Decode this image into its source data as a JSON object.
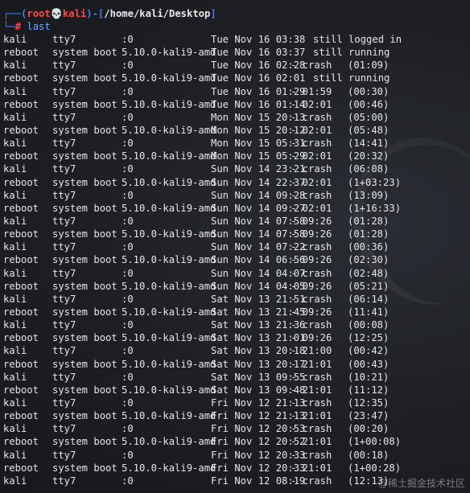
{
  "prompt": {
    "open": "┌──(",
    "user": "root",
    "skull": "💀",
    "host": "kali",
    "sep": ")-[",
    "path": "/home/kali/Desktop",
    "close": "]"
  },
  "command": {
    "prefix": "└─",
    "hash": "#",
    "text": "last"
  },
  "rows": [
    {
      "user": "kali",
      "tty": "tty7",
      "host": ":0",
      "date": "Tue Nov 16 03:38",
      "time": "",
      "status": "still logged in"
    },
    {
      "user": "reboot",
      "tty": "system boot",
      "host": "5.10.0-kali9-amd",
      "date": "Tue Nov 16 03:37",
      "time": "",
      "status": "still running"
    },
    {
      "user": "kali",
      "tty": "tty7",
      "host": ":0",
      "date": "Tue Nov 16 02:28",
      "time": "- crash",
      "status": "(01:09)"
    },
    {
      "user": "reboot",
      "tty": "system boot",
      "host": "5.10.0-kali9-amd",
      "date": "Tue Nov 16 02:01",
      "time": "",
      "status": "still running"
    },
    {
      "user": "kali",
      "tty": "tty7",
      "host": ":0",
      "date": "Tue Nov 16 01:29",
      "time": "- 01:59",
      "status": "(00:30)"
    },
    {
      "user": "reboot",
      "tty": "system boot",
      "host": "5.10.0-kali9-amd",
      "date": "Tue Nov 16 01:14",
      "time": "- 02:01",
      "status": "(00:46)"
    },
    {
      "user": "kali",
      "tty": "tty7",
      "host": ":0",
      "date": "Mon Nov 15 20:13",
      "time": "- crash",
      "status": "(05:00)"
    },
    {
      "user": "reboot",
      "tty": "system boot",
      "host": "5.10.0-kali9-amd",
      "date": "Mon Nov 15 20:12",
      "time": "- 02:01",
      "status": "(05:48)"
    },
    {
      "user": "kali",
      "tty": "tty7",
      "host": ":0",
      "date": "Mon Nov 15 05:31",
      "time": "- crash",
      "status": "(14:41)"
    },
    {
      "user": "reboot",
      "tty": "system boot",
      "host": "5.10.0-kali9-amd",
      "date": "Mon Nov 15 05:29",
      "time": "- 02:01",
      "status": "(20:32)"
    },
    {
      "user": "kali",
      "tty": "tty7",
      "host": ":0",
      "date": "Sun Nov 14 23:21",
      "time": "- crash",
      "status": "(06:08)"
    },
    {
      "user": "reboot",
      "tty": "system boot",
      "host": "5.10.0-kali9-amd",
      "date": "Sun Nov 14 22:37",
      "time": "- 02:01",
      "status": "(1+03:23)"
    },
    {
      "user": "kali",
      "tty": "tty7",
      "host": ":0",
      "date": "Sun Nov 14 09:28",
      "time": "- crash",
      "status": "(13:09)"
    },
    {
      "user": "reboot",
      "tty": "system boot",
      "host": "5.10.0-kali9-amd",
      "date": "Sun Nov 14 09:27",
      "time": "- 02:01",
      "status": "(1+16:33)"
    },
    {
      "user": "kali",
      "tty": "tty7",
      "host": ":0",
      "date": "Sun Nov 14 07:58",
      "time": "- 09:26",
      "status": "(01:28)"
    },
    {
      "user": "reboot",
      "tty": "system boot",
      "host": "5.10.0-kali9-amd",
      "date": "Sun Nov 14 07:58",
      "time": "- 09:26",
      "status": "(01:28)"
    },
    {
      "user": "kali",
      "tty": "tty7",
      "host": ":0",
      "date": "Sun Nov 14 07:22",
      "time": "- crash",
      "status": "(00:36)"
    },
    {
      "user": "reboot",
      "tty": "system boot",
      "host": "5.10.0-kali9-amd",
      "date": "Sun Nov 14 06:56",
      "time": "- 09:26",
      "status": "(02:30)"
    },
    {
      "user": "kali",
      "tty": "tty7",
      "host": ":0",
      "date": "Sun Nov 14 04:07",
      "time": "- crash",
      "status": "(02:48)"
    },
    {
      "user": "reboot",
      "tty": "system boot",
      "host": "5.10.0-kali9-amd",
      "date": "Sun Nov 14 04:05",
      "time": "- 09:26",
      "status": "(05:21)"
    },
    {
      "user": "kali",
      "tty": "tty7",
      "host": ":0",
      "date": "Sat Nov 13 21:51",
      "time": "- crash",
      "status": "(06:14)"
    },
    {
      "user": "reboot",
      "tty": "system boot",
      "host": "5.10.0-kali9-amd",
      "date": "Sat Nov 13 21:45",
      "time": "- 09:26",
      "status": "(11:41)"
    },
    {
      "user": "kali",
      "tty": "tty7",
      "host": ":0",
      "date": "Sat Nov 13 21:36",
      "time": "- crash",
      "status": "(00:08)"
    },
    {
      "user": "reboot",
      "tty": "system boot",
      "host": "5.10.0-kali9-amd",
      "date": "Sat Nov 13 21:01",
      "time": "- 09:26",
      "status": "(12:25)"
    },
    {
      "user": "kali",
      "tty": "tty7",
      "host": ":0",
      "date": "Sat Nov 13 20:18",
      "time": "- 21:00",
      "status": "(00:42)"
    },
    {
      "user": "reboot",
      "tty": "system boot",
      "host": "5.10.0-kali9-amd",
      "date": "Sat Nov 13 20:17",
      "time": "- 21:01",
      "status": "(00:43)"
    },
    {
      "user": "kali",
      "tty": "tty7",
      "host": ":0",
      "date": "Sat Nov 13 09:55",
      "time": "- crash",
      "status": "(10:21)"
    },
    {
      "user": "reboot",
      "tty": "system boot",
      "host": "5.10.0-kali9-amd",
      "date": "Sat Nov 13 09:48",
      "time": "- 21:01",
      "status": "(11:12)"
    },
    {
      "user": "kali",
      "tty": "tty7",
      "host": ":0",
      "date": "Fri Nov 12 21:13",
      "time": "- crash",
      "status": "(12:35)"
    },
    {
      "user": "reboot",
      "tty": "system boot",
      "host": "5.10.0-kali9-amd",
      "date": "Fri Nov 12 21:13",
      "time": "- 21:01",
      "status": "(23:47)"
    },
    {
      "user": "kali",
      "tty": "tty7",
      "host": ":0",
      "date": "Fri Nov 12 20:53",
      "time": "- crash",
      "status": "(00:20)"
    },
    {
      "user": "reboot",
      "tty": "system boot",
      "host": "5.10.0-kali9-amd",
      "date": "Fri Nov 12 20:52",
      "time": "- 21:01",
      "status": "(1+00:08)"
    },
    {
      "user": "kali",
      "tty": "tty7",
      "host": ":0",
      "date": "Fri Nov 12 20:33",
      "time": "- crash",
      "status": "(00:18)"
    },
    {
      "user": "reboot",
      "tty": "system boot",
      "host": "5.10.0-kali9-amd",
      "date": "Fri Nov 12 20:33",
      "time": "- 21:01",
      "status": "(1+00:28)"
    },
    {
      "user": "kali",
      "tty": "tty7",
      "host": ":0",
      "date": "Fri Nov 12 08:19",
      "time": "- crash",
      "status": "(12:13)"
    }
  ],
  "watermark": "@稀土掘金技术社区"
}
